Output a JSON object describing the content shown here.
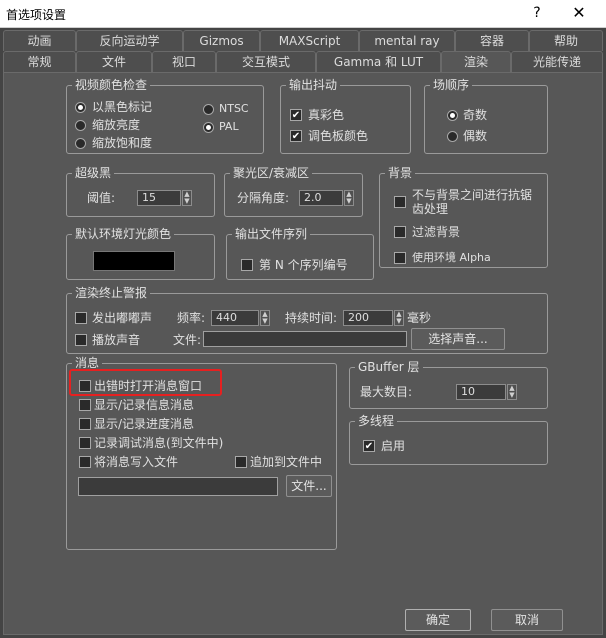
{
  "window": {
    "title": "首选项设置",
    "help": "?",
    "close": "✕"
  },
  "tabs_row1": [
    "动画",
    "反向运动学",
    "Gizmos",
    "MAXScript",
    "mental ray",
    "容器",
    "帮助"
  ],
  "tabs_row2": [
    "常规",
    "文件",
    "视口",
    "交互模式",
    "Gamma 和 LUT",
    "渲染",
    "光能传递"
  ],
  "active_tab": "渲染",
  "video_color_check": {
    "title": "视频颜色检查",
    "options": [
      "以黑色标记",
      "缩放亮度",
      "缩放饱和度"
    ],
    "standards": [
      "NTSC",
      "PAL"
    ]
  },
  "output_dither": {
    "title": "输出抖动",
    "true_color": "真彩色",
    "palette_color": "调色板颜色"
  },
  "field_order": {
    "title": "场顺序",
    "odd": "奇数",
    "even": "偶数"
  },
  "super_black": {
    "title": "超级黑",
    "threshold_label": "阈值:",
    "threshold_value": "15"
  },
  "hotspot_falloff": {
    "title": "聚光区/衰减区",
    "angle_label": "分隔角度:",
    "angle_value": "2.0"
  },
  "background": {
    "title": "背景",
    "antialias": "不与背景之间进行抗锯齿处理",
    "filter": "过滤背景",
    "use_env_alpha": "使用环境 Alpha"
  },
  "ambient_light": {
    "title": "默认环境灯光颜色",
    "color": "#000000"
  },
  "output_sequence": {
    "title": "输出文件序列",
    "nth": "第 N 个序列编号"
  },
  "render_termination": {
    "title": "渲染终止警报",
    "beep": "发出嘟嘟声",
    "freq_label": "频率:",
    "freq_value": "440",
    "duration_label": "持续时间:",
    "duration_value": "200",
    "ms": "毫秒",
    "play_sound": "播放声音",
    "file_label": "文件:",
    "choose_sound": "选择声音..."
  },
  "messages": {
    "title": "消息",
    "open_on_error": "出错时打开消息窗口",
    "show_info": "显示/记录信息消息",
    "show_progress": "显示/记录进度消息",
    "log_debug": "记录调试消息(到文件中)",
    "write_to_file": "将消息写入文件",
    "append": "追加到文件中",
    "file_button": "文件..."
  },
  "gbuffer": {
    "title": "GBuffer 层",
    "max_label": "最大数目:",
    "max_value": "10"
  },
  "multithread": {
    "title": "多线程",
    "enable": "启用"
  },
  "footer": {
    "ok": "确定",
    "cancel": "取消"
  },
  "check": "✔"
}
